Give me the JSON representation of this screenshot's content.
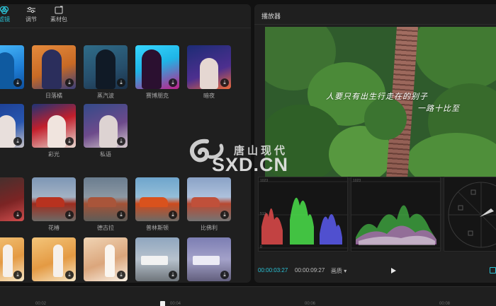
{
  "top_tabs": [
    {
      "label": "滤镜",
      "icon": "filter-icon",
      "active": true
    },
    {
      "label": "调节",
      "icon": "adjust-sliders-icon",
      "active": false
    },
    {
      "label": "素材包",
      "icon": "material-pack-icon",
      "active": false
    }
  ],
  "filters": {
    "row1": [
      "",
      "日落橘",
      "蒸汽波",
      "赛博朋克",
      "暗夜"
    ],
    "row2": [
      "",
      "彩光",
      "私语"
    ],
    "row3": [
      "",
      "花椿",
      "德古拉",
      "普林斯顿",
      "比佛利"
    ],
    "row4": [
      "",
      "",
      "",
      "",
      ""
    ]
  },
  "download_glyph": "⤓",
  "player": {
    "title": "播放器",
    "overlay_line1": "人要只有出生行走在的别子",
    "overlay_line2": "一路十比至",
    "watermark_cn": "唐山现代",
    "watermark_en": "SXD.CN",
    "current_time": "00:00:03:27",
    "duration": "00:00:09:27",
    "quality": "画质 ▾",
    "scope_top_value": "1023",
    "scope_mid_value": "512",
    "scope_low_value": "0"
  },
  "timeline": {
    "ticks": [
      "00:02",
      "00:04",
      "00:06",
      "00:08"
    ]
  },
  "colors": {
    "accent": "#2bc4d8",
    "panel": "#1f1f1f"
  }
}
